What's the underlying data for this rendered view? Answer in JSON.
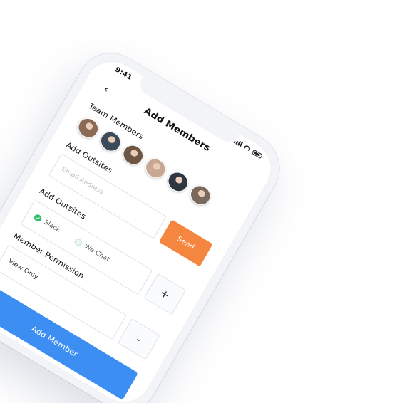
{
  "status": {
    "time": "9:41"
  },
  "header": {
    "title": "Add Members",
    "back_icon": "chevron-left-icon"
  },
  "team": {
    "label": "Team Members",
    "avatars": [
      {
        "color": "#8c6b55"
      },
      {
        "color": "#3d4a5a"
      },
      {
        "color": "#6e5644"
      },
      {
        "color": "#c8a893"
      },
      {
        "color": "#2e3640"
      },
      {
        "color": "#7a6a5e"
      }
    ]
  },
  "email": {
    "label": "Add Outsites",
    "placeholder": "Email Address",
    "send_label": "Send"
  },
  "outsites": {
    "label": "Add Outsites",
    "options": [
      {
        "label": "Slack",
        "selected": true
      },
      {
        "label": "We Chat",
        "selected": false
      }
    ],
    "add_icon": "plus-icon"
  },
  "permission": {
    "label": "Member Permission",
    "value": "View Only",
    "dropdown_icon": "chevron-down-icon"
  },
  "action": {
    "add_member_label": "Add Member"
  },
  "colors": {
    "accent": "#3c8ef3",
    "send": "#f4863f",
    "success": "#2ec26a"
  }
}
